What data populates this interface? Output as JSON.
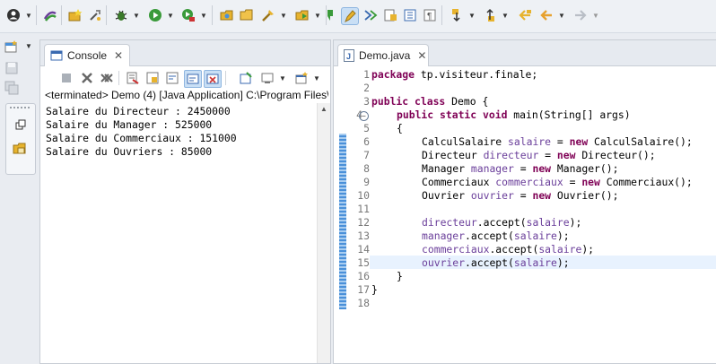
{
  "console": {
    "tab_label": "Console",
    "status_line": "<terminated> Demo (4) [Java Application] C:\\Program Files\\",
    "output_lines": [
      "Salaire du Directeur : 2450000",
      "Salaire du Manager : 525000",
      "Salaire du Commerciaux : 151000",
      "Salaire du Ouvriers : 85000"
    ]
  },
  "editor": {
    "tab_label": "Demo.java",
    "line_numbers": [
      "1",
      "2",
      "3",
      "4",
      "5",
      "6",
      "7",
      "8",
      "9",
      "10",
      "11",
      "12",
      "13",
      "14",
      "15",
      "16",
      "17",
      "18"
    ],
    "code": {
      "l1_kw": "package",
      "l1_rest": " tp.visiteur.finale;",
      "l3_kw": "public class",
      "l3_rest": " Demo {",
      "l4_kw": "public static void",
      "l4_rest": " main(String[] args)",
      "l5": "{",
      "l6_type": "CalculSalaire ",
      "l6_var": "salaire",
      "l6_eq": " = ",
      "l6_new": "new",
      "l6_rest": " CalculSalaire();",
      "l7_type": "Directeur ",
      "l7_var": "directeur",
      "l7_eq": " = ",
      "l7_new": "new",
      "l7_rest": " Directeur();",
      "l8_type": "Manager ",
      "l8_var": "manager",
      "l8_eq": " = ",
      "l8_new": "new",
      "l8_rest": " Manager();",
      "l9_type": "Commerciaux ",
      "l9_var": "commerciaux",
      "l9_eq": " = ",
      "l9_new": "new",
      "l9_rest": " Commerciaux();",
      "l10_type": "Ouvrier ",
      "l10_var": "ouvrier",
      "l10_eq": " = ",
      "l10_new": "new",
      "l10_rest": " Ouvrier();",
      "l12_var": "directeur",
      "l12_mid": ".accept(",
      "l12_arg": "salaire",
      "l12_end": ");",
      "l13_var": "manager",
      "l13_mid": ".accept(",
      "l13_arg": "salaire",
      "l13_end": ");",
      "l14_var": "commerciaux",
      "l14_mid": ".accept(",
      "l14_arg": "salaire",
      "l14_end": ");",
      "l15_var": "ouvrier",
      "l15_mid": ".accept(",
      "l15_arg": "salaire",
      "l15_end": ");",
      "l16": "}",
      "l17": "}"
    }
  },
  "icons": {
    "colors": {
      "run": "#3a9a3a",
      "debug": "#2b7a2b",
      "folder": "#e7b32e",
      "accent": "#4a90d9"
    }
  }
}
